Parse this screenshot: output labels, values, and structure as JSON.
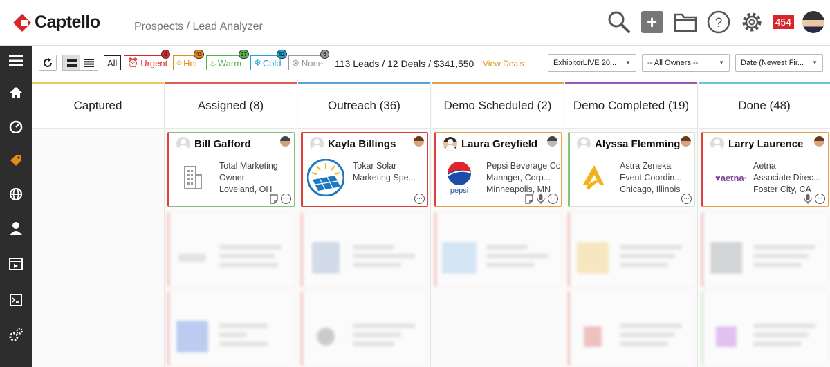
{
  "app": {
    "name": "Captello"
  },
  "breadcrumb": "Prospects / Lead Analyzer",
  "header": {
    "notification_count": "454"
  },
  "filters": {
    "all_label": "All",
    "chips": [
      {
        "label": "Urgent",
        "count": "0",
        "color": "#d8262b"
      },
      {
        "label": "Hot",
        "count": "43",
        "color": "#e9881b"
      },
      {
        "label": "Warm",
        "count": "27",
        "color": "#57b44a"
      },
      {
        "label": "Cold",
        "count": "52",
        "color": "#1fa2d6"
      },
      {
        "label": "None",
        "count": "6",
        "color": "#999999"
      }
    ],
    "summary": "113 Leads / 12 Deals / $341,550",
    "view_deals": "View Deals",
    "event_select": "ExhibitorLIVE 20...",
    "owner_select": "-- All Owners --",
    "sort_select": "Date (Newest Fir..."
  },
  "columns": [
    {
      "title": "Captured",
      "color": "#e9c85c"
    },
    {
      "title": "Assigned (8)",
      "color": "#e05a52"
    },
    {
      "title": "Outreach (36)",
      "color": "#5aa2d8"
    },
    {
      "title": "Demo Scheduled (2)",
      "color": "#e9a04a"
    },
    {
      "title": "Demo Completed (19)",
      "color": "#9b59b6"
    },
    {
      "title": "Done (48)",
      "color": "#6cc3d9"
    }
  ],
  "cards": [
    {
      "name": "Bill Gafford",
      "company": "Total Marketing",
      "role": "Owner",
      "location": "Loveland, OH",
      "logo": "building-icon",
      "border": "#7fc47a",
      "left": "#e0403c"
    },
    {
      "name": "Kayla Billings",
      "company": "Tokar Solar",
      "role": "Marketing Spe...",
      "location": "",
      "logo": "solar-panel-logo",
      "border": "#e0403c",
      "left": "#e0403c"
    },
    {
      "name": "Laura Greyfield",
      "company": "Pepsi Beverage Co.",
      "role": "Manager, Corp...",
      "location": "Minneapolis, MN",
      "logo": "pepsi-logo",
      "logo_text": "pepsi",
      "border": "#e9a04a",
      "left": "#e0403c"
    },
    {
      "name": "Alyssa Flemming",
      "company": "Astra Zeneka",
      "role": "Event Coordin...",
      "location": "Chicago, Illinois",
      "logo": "astrazeneca-logo",
      "border": "#cfe8cc",
      "left": "#7fc47a"
    },
    {
      "name": "Larry Laurence",
      "company": "Aetna",
      "role": "Associate Direc...",
      "location": "Foster City, CA",
      "logo": "aetna-logo",
      "logo_text": "♥aetna·",
      "border": "#e9a04a",
      "left": "#e0403c"
    }
  ]
}
